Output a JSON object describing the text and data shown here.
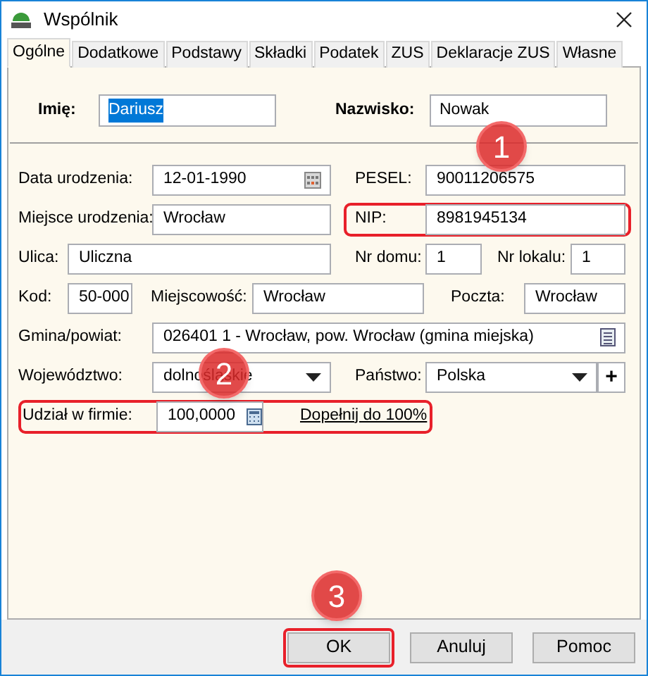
{
  "window": {
    "title": "Wspólnik"
  },
  "tabs": [
    {
      "label": "Ogólne",
      "selected": true
    },
    {
      "label": "Dodatkowe",
      "selected": false
    },
    {
      "label": "Podstawy",
      "selected": false
    },
    {
      "label": "Składki",
      "selected": false
    },
    {
      "label": "Podatek",
      "selected": false
    },
    {
      "label": "ZUS",
      "selected": false
    },
    {
      "label": "Deklaracje ZUS",
      "selected": false
    },
    {
      "label": "Własne",
      "selected": false
    }
  ],
  "names": [
    {
      "label": "Imię:",
      "value": "Dariusz",
      "selected": true
    },
    {
      "label": "Nazwisko:",
      "value": "Nowak",
      "selected": false
    }
  ],
  "rows": [
    {
      "fields": [
        {
          "kind": "date",
          "label": "Data urodzenia:",
          "value": "12-01-1990",
          "highlighted": false
        },
        {
          "kind": "text",
          "label": "PESEL:",
          "value": "90011206575",
          "highlighted": false
        }
      ]
    },
    {
      "fields": [
        {
          "kind": "text",
          "label": "Miejsce urodzenia:",
          "value": "Wrocław",
          "highlighted": false
        },
        {
          "kind": "text",
          "label": "NIP:",
          "value": "8981945134",
          "highlighted": true
        }
      ]
    },
    {
      "fields": [
        {
          "kind": "text",
          "label": "Ulica:",
          "value": "Uliczna",
          "highlighted": false
        },
        {
          "kind": "text",
          "label": "Nr domu:",
          "value": "1",
          "highlighted": false
        },
        {
          "kind": "text",
          "label": "Nr lokalu:",
          "value": "1",
          "highlighted": false
        }
      ]
    },
    {
      "fields": [
        {
          "kind": "text",
          "label": "Kod:",
          "value": "50-000",
          "highlighted": false
        },
        {
          "kind": "text",
          "label": "Miejscowość:",
          "value": "Wrocław",
          "highlighted": false
        },
        {
          "kind": "text",
          "label": "Poczta:",
          "value": "Wrocław",
          "highlighted": false
        }
      ]
    },
    {
      "fields": [
        {
          "kind": "lookup",
          "label": "Gmina/powiat:",
          "value": "026401 1 - Wrocław, pow. Wrocław (gmina miejska)",
          "highlighted": false
        }
      ]
    },
    {
      "fields": [
        {
          "kind": "select",
          "label": "Województwo:",
          "value": "dolnośląskie",
          "highlighted": false
        },
        {
          "kind": "select",
          "label": "Państwo:",
          "value": "Polska",
          "add_button": "+",
          "highlighted": false
        }
      ]
    },
    {
      "fields": [
        {
          "kind": "share",
          "label": "Udział w firmie:",
          "value": "100,0000",
          "link": "Dopełnij do 100%",
          "highlighted": true
        }
      ]
    }
  ],
  "buttons": [
    {
      "label": "OK",
      "highlighted": true
    },
    {
      "label": "Anuluj",
      "highlighted": false
    },
    {
      "label": "Pomoc",
      "highlighted": false
    }
  ],
  "annotations": [
    {
      "number": "1"
    },
    {
      "number": "2"
    },
    {
      "number": "3"
    }
  ]
}
